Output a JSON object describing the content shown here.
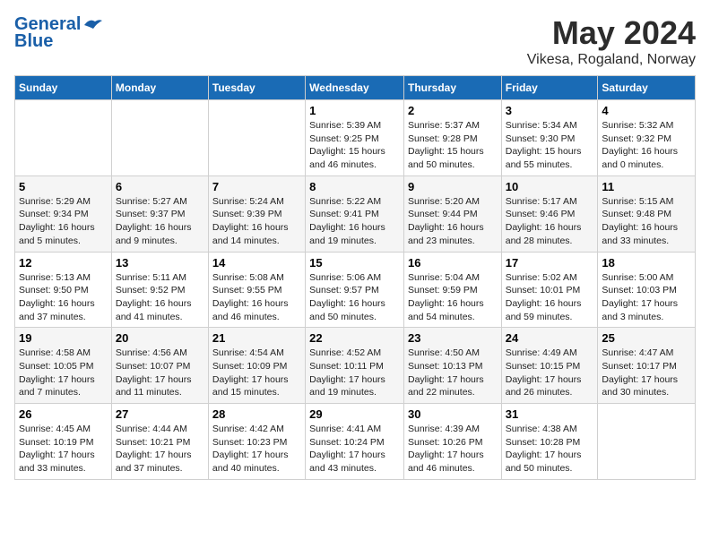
{
  "logo": {
    "line1": "General",
    "line2": "Blue"
  },
  "title": "May 2024",
  "subtitle": "Vikesa, Rogaland, Norway",
  "weekdays": [
    "Sunday",
    "Monday",
    "Tuesday",
    "Wednesday",
    "Thursday",
    "Friday",
    "Saturday"
  ],
  "weeks": [
    [
      {
        "day": "",
        "info": ""
      },
      {
        "day": "",
        "info": ""
      },
      {
        "day": "",
        "info": ""
      },
      {
        "day": "1",
        "info": "Sunrise: 5:39 AM\nSunset: 9:25 PM\nDaylight: 15 hours\nand 46 minutes."
      },
      {
        "day": "2",
        "info": "Sunrise: 5:37 AM\nSunset: 9:28 PM\nDaylight: 15 hours\nand 50 minutes."
      },
      {
        "day": "3",
        "info": "Sunrise: 5:34 AM\nSunset: 9:30 PM\nDaylight: 15 hours\nand 55 minutes."
      },
      {
        "day": "4",
        "info": "Sunrise: 5:32 AM\nSunset: 9:32 PM\nDaylight: 16 hours\nand 0 minutes."
      }
    ],
    [
      {
        "day": "5",
        "info": "Sunrise: 5:29 AM\nSunset: 9:34 PM\nDaylight: 16 hours\nand 5 minutes."
      },
      {
        "day": "6",
        "info": "Sunrise: 5:27 AM\nSunset: 9:37 PM\nDaylight: 16 hours\nand 9 minutes."
      },
      {
        "day": "7",
        "info": "Sunrise: 5:24 AM\nSunset: 9:39 PM\nDaylight: 16 hours\nand 14 minutes."
      },
      {
        "day": "8",
        "info": "Sunrise: 5:22 AM\nSunset: 9:41 PM\nDaylight: 16 hours\nand 19 minutes."
      },
      {
        "day": "9",
        "info": "Sunrise: 5:20 AM\nSunset: 9:44 PM\nDaylight: 16 hours\nand 23 minutes."
      },
      {
        "day": "10",
        "info": "Sunrise: 5:17 AM\nSunset: 9:46 PM\nDaylight: 16 hours\nand 28 minutes."
      },
      {
        "day": "11",
        "info": "Sunrise: 5:15 AM\nSunset: 9:48 PM\nDaylight: 16 hours\nand 33 minutes."
      }
    ],
    [
      {
        "day": "12",
        "info": "Sunrise: 5:13 AM\nSunset: 9:50 PM\nDaylight: 16 hours\nand 37 minutes."
      },
      {
        "day": "13",
        "info": "Sunrise: 5:11 AM\nSunset: 9:52 PM\nDaylight: 16 hours\nand 41 minutes."
      },
      {
        "day": "14",
        "info": "Sunrise: 5:08 AM\nSunset: 9:55 PM\nDaylight: 16 hours\nand 46 minutes."
      },
      {
        "day": "15",
        "info": "Sunrise: 5:06 AM\nSunset: 9:57 PM\nDaylight: 16 hours\nand 50 minutes."
      },
      {
        "day": "16",
        "info": "Sunrise: 5:04 AM\nSunset: 9:59 PM\nDaylight: 16 hours\nand 54 minutes."
      },
      {
        "day": "17",
        "info": "Sunrise: 5:02 AM\nSunset: 10:01 PM\nDaylight: 16 hours\nand 59 minutes."
      },
      {
        "day": "18",
        "info": "Sunrise: 5:00 AM\nSunset: 10:03 PM\nDaylight: 17 hours\nand 3 minutes."
      }
    ],
    [
      {
        "day": "19",
        "info": "Sunrise: 4:58 AM\nSunset: 10:05 PM\nDaylight: 17 hours\nand 7 minutes."
      },
      {
        "day": "20",
        "info": "Sunrise: 4:56 AM\nSunset: 10:07 PM\nDaylight: 17 hours\nand 11 minutes."
      },
      {
        "day": "21",
        "info": "Sunrise: 4:54 AM\nSunset: 10:09 PM\nDaylight: 17 hours\nand 15 minutes."
      },
      {
        "day": "22",
        "info": "Sunrise: 4:52 AM\nSunset: 10:11 PM\nDaylight: 17 hours\nand 19 minutes."
      },
      {
        "day": "23",
        "info": "Sunrise: 4:50 AM\nSunset: 10:13 PM\nDaylight: 17 hours\nand 22 minutes."
      },
      {
        "day": "24",
        "info": "Sunrise: 4:49 AM\nSunset: 10:15 PM\nDaylight: 17 hours\nand 26 minutes."
      },
      {
        "day": "25",
        "info": "Sunrise: 4:47 AM\nSunset: 10:17 PM\nDaylight: 17 hours\nand 30 minutes."
      }
    ],
    [
      {
        "day": "26",
        "info": "Sunrise: 4:45 AM\nSunset: 10:19 PM\nDaylight: 17 hours\nand 33 minutes."
      },
      {
        "day": "27",
        "info": "Sunrise: 4:44 AM\nSunset: 10:21 PM\nDaylight: 17 hours\nand 37 minutes."
      },
      {
        "day": "28",
        "info": "Sunrise: 4:42 AM\nSunset: 10:23 PM\nDaylight: 17 hours\nand 40 minutes."
      },
      {
        "day": "29",
        "info": "Sunrise: 4:41 AM\nSunset: 10:24 PM\nDaylight: 17 hours\nand 43 minutes."
      },
      {
        "day": "30",
        "info": "Sunrise: 4:39 AM\nSunset: 10:26 PM\nDaylight: 17 hours\nand 46 minutes."
      },
      {
        "day": "31",
        "info": "Sunrise: 4:38 AM\nSunset: 10:28 PM\nDaylight: 17 hours\nand 50 minutes."
      },
      {
        "day": "",
        "info": ""
      }
    ]
  ]
}
